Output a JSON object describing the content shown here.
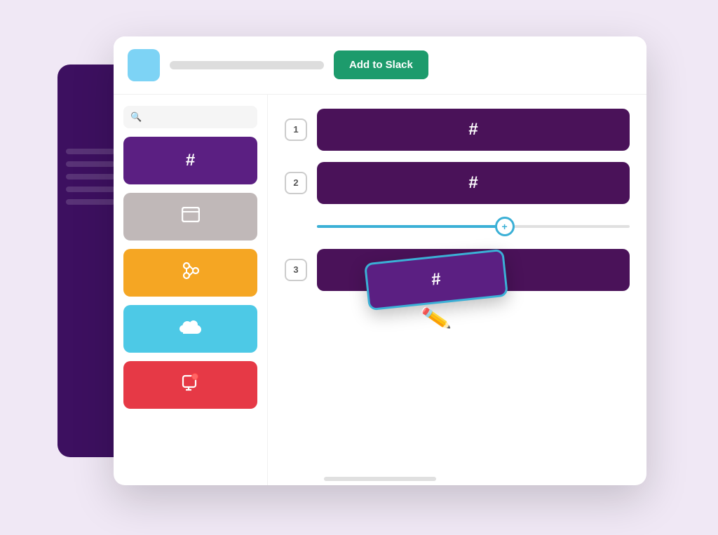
{
  "header": {
    "avatar_color": "#7dd3f5",
    "title_placeholder": "",
    "add_to_slack_label": "Add to Slack"
  },
  "sidebar": {
    "bg_color": "#3d1060",
    "lines": [
      1,
      2,
      3,
      4,
      5
    ]
  },
  "left_panel": {
    "search_placeholder": "Search",
    "apps": [
      {
        "id": "slack",
        "color": "#5b1f82",
        "icon": "hash",
        "label": "Slack"
      },
      {
        "id": "window",
        "color": "#c0b8b8",
        "icon": "window",
        "label": "Window"
      },
      {
        "id": "source",
        "color": "#f5a623",
        "icon": "source",
        "label": "Source Control"
      },
      {
        "id": "cloud",
        "color": "#4dc9e6",
        "icon": "cloud",
        "label": "Cloud"
      },
      {
        "id": "notification",
        "color": "#e63946",
        "icon": "notification",
        "label": "Notifications"
      }
    ]
  },
  "right_panel": {
    "rows": [
      {
        "number": "1",
        "color": "#4a1259"
      },
      {
        "number": "2",
        "color": "#4a1259"
      },
      {
        "number": "3",
        "color": "#4a1259"
      }
    ],
    "slider": {
      "fill_percent": 60,
      "thumb_symbol": "+"
    }
  },
  "dragging_tile": {
    "color": "#5b1f82",
    "border_color": "#3bb0d6"
  },
  "icons": {
    "hash": "#",
    "search": "🔍",
    "window": "⬜",
    "source": "⑂",
    "cloud": "☁",
    "notification": "🔔",
    "cursor": "☛"
  }
}
